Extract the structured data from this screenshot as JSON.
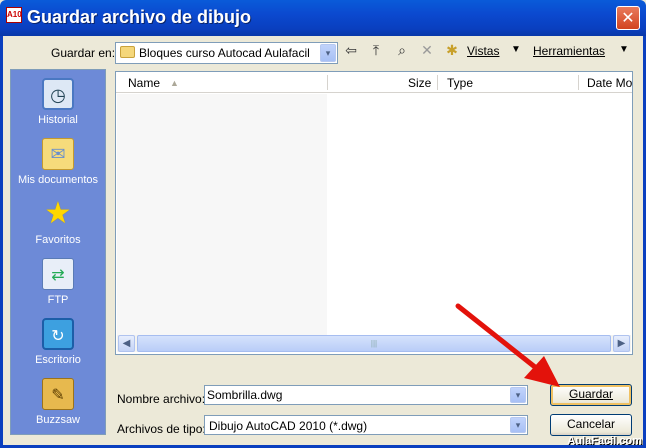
{
  "window": {
    "title": "Guardar archivo de dibujo",
    "app_icon_text": "A10",
    "close_glyph": "✕"
  },
  "toolbar": {
    "lookin_label": "Guardar en:",
    "lookin_value": "Bloques curso Autocad Aulafacil",
    "back_icon": "⇦",
    "up_icon": "⤒",
    "search_icon": "⌕",
    "delete_icon": "✕",
    "newfolder_icon": "✱",
    "views_label": "Vistas",
    "tools_label": "Herramientas",
    "caret": "▼"
  },
  "places": [
    {
      "label": "Historial",
      "icon": "clock-icon",
      "glyph": "◷"
    },
    {
      "label": "Mis documentos",
      "icon": "folder-documents-icon",
      "glyph": "✉"
    },
    {
      "label": "Favoritos",
      "icon": "star-icon",
      "glyph": "★"
    },
    {
      "label": "FTP",
      "icon": "ftp-icon",
      "glyph": "⇄"
    },
    {
      "label": "Escritorio",
      "icon": "desktop-icon",
      "glyph": "↻"
    },
    {
      "label": "Buzzsaw",
      "icon": "buzzsaw-icon",
      "glyph": "✎"
    }
  ],
  "filelist": {
    "columns": [
      "Name",
      "Size",
      "Type",
      "Date Mo"
    ],
    "sort_glyph": "▲",
    "scroll_left": "◀",
    "scroll_right": "▶",
    "thumb_grip": "|||"
  },
  "form": {
    "filename_label": "Nombre archivo:",
    "filename_value": "Sombrilla.dwg",
    "filetype_label": "Archivos de tipo:",
    "filetype_value": "Dibujo AutoCAD 2010 (*.dwg)",
    "dropdown_glyph": "▾"
  },
  "buttons": {
    "save": "Guardar",
    "cancel": "Cancelar"
  },
  "watermark": "AulaFacil.com",
  "colors": {
    "titlebar": "#0a4fd0",
    "places_bar": "#6d8ad7",
    "annotation_arrow": "#e3120b"
  }
}
